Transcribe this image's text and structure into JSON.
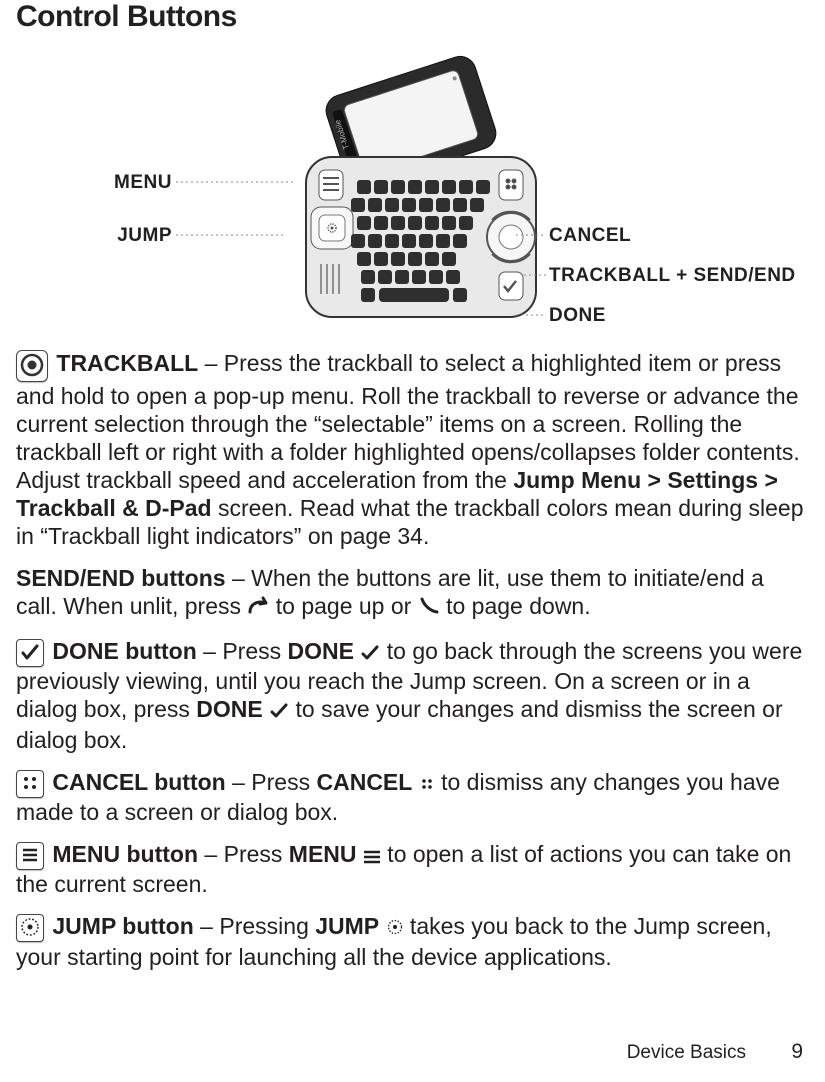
{
  "title": "Control Buttons",
  "diagram": {
    "labels": {
      "menu": "MENU",
      "jump": "JUMP",
      "cancel": "CANCEL",
      "trackball_send_end": "TRACKBALL + SEND/END",
      "done": "DONE"
    }
  },
  "paragraphs": {
    "trackball": {
      "lead": "TRACKBALL",
      "sep": " – ",
      "t1": "Press the trackball to select a highlighted item or press and hold to open a pop-up menu. Roll the trackball to reverse or advance the current selection through the “selectable” items on a screen. Rolling the trackball left or right with a folder highlighted opens/collapses folder contents. Adjust trackball speed and acceleration from the ",
      "bold1": "Jump Menu > Settings > Trackball & D-Pad",
      "t2": " screen. Read what the trackball colors mean during sleep in “Trackball light indicators” on page 34."
    },
    "sendend": {
      "lead": "SEND/END buttons",
      "sep": " – ",
      "t1": "When the buttons are lit, use them to initiate/end a call. When unlit, press ",
      "t2": " to page up or ",
      "t3": " to page down."
    },
    "done": {
      "lead": "DONE button",
      "sep": " – ",
      "t1": "Press ",
      "bold1": "DONE",
      "t2": " to go back through the screens you were previously viewing, until you reach the Jump screen. On a screen or in a dialog box, press ",
      "bold2": "DONE",
      "t3": " to save your changes and dismiss the screen or dialog box."
    },
    "cancel": {
      "lead": "CANCEL button",
      "sep": " – ",
      "t1": "Press ",
      "bold1": "CANCEL",
      "t2": " to dismiss any changes you have made to a screen or dialog box."
    },
    "menu": {
      "lead": "MENU button",
      "sep": " – ",
      "t1": "Press ",
      "bold1": "MENU",
      "t2": " to open a list of actions you can take on the current screen."
    },
    "jump": {
      "lead": "JUMP button",
      "sep": " – ",
      "t1": "Pressing ",
      "bold1": "JUMP",
      "t2": " takes you back to the Jump screen, your starting point for launching all the device applications."
    }
  },
  "footer": {
    "section": "Device Basics",
    "page": "9"
  }
}
